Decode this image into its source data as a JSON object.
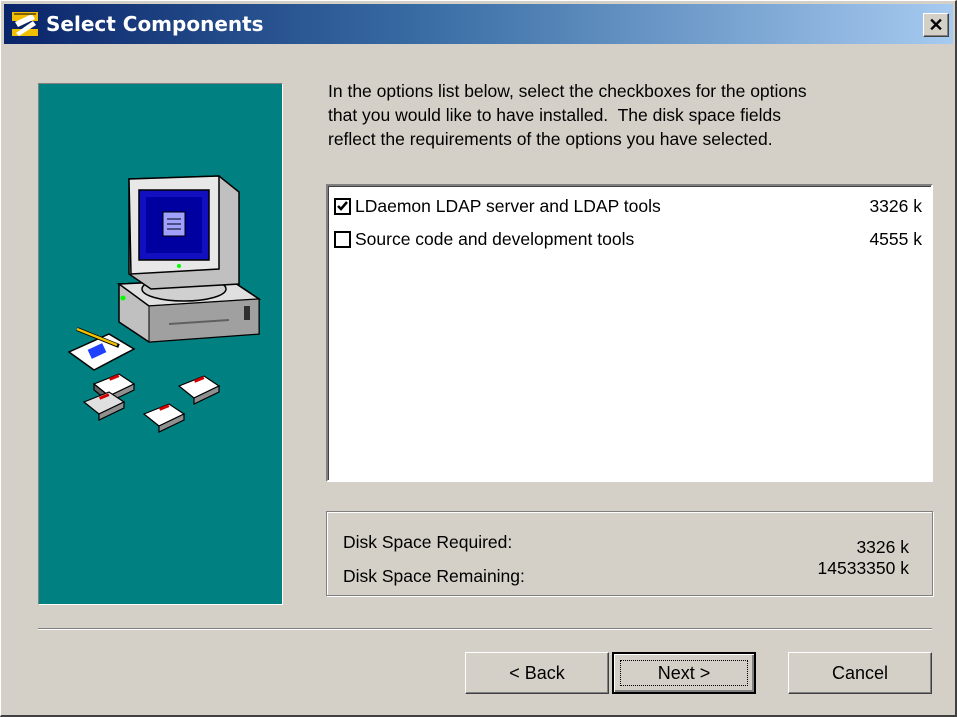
{
  "window": {
    "title": "Select Components"
  },
  "colors": {
    "title_gradient_start": "#0a246a",
    "title_gradient_end": "#a6caf0",
    "side_panel": "#008080",
    "dialog_face": "#d4d0c8"
  },
  "icons": {
    "app": "setup-app-icon",
    "close": "close-icon",
    "illustration": "computer-with-disks-illustration"
  },
  "intro": {
    "line1": "In the options list below, select the checkboxes for the options",
    "line2": "that you would like to have installed.  The disk space fields",
    "line3": "reflect the requirements of the options you have selected."
  },
  "components": [
    {
      "label": "LDaemon LDAP server and LDAP tools",
      "size": "3326 k",
      "checked": true
    },
    {
      "label": "Source code and development tools",
      "size": "4555 k",
      "checked": false
    }
  ],
  "disk_space": {
    "required_label": "Disk Space Required:",
    "required_value": "3326 k",
    "remaining_label": "Disk Space Remaining:",
    "remaining_value": "14533350 k"
  },
  "buttons": {
    "back": "< Back",
    "next": "Next >",
    "cancel": "Cancel"
  }
}
